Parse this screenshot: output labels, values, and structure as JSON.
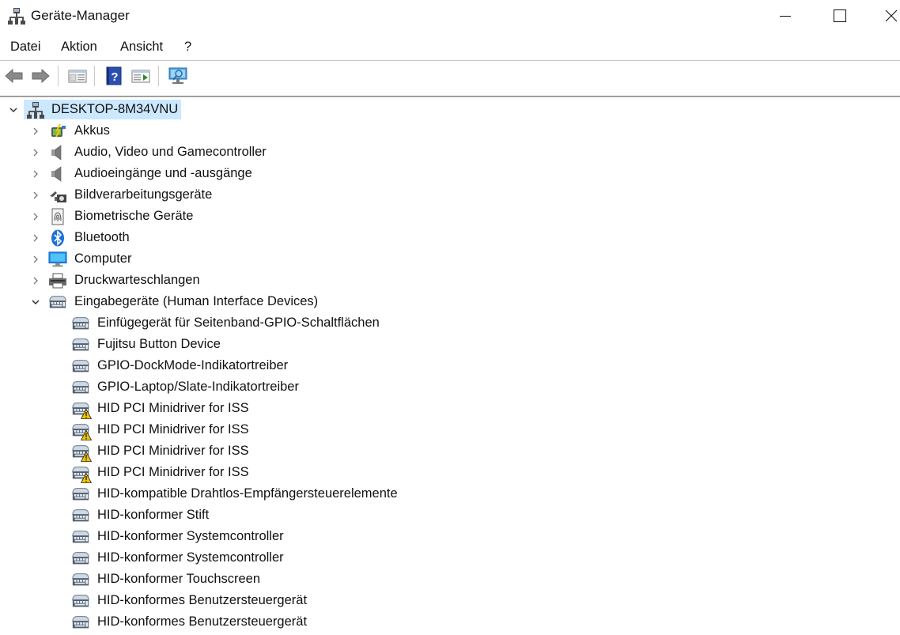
{
  "window": {
    "title": "Geräte-Manager"
  },
  "menu": [
    {
      "label": "Datei"
    },
    {
      "label": "Aktion"
    },
    {
      "label": "Ansicht"
    },
    {
      "label": "?"
    }
  ],
  "toolbar": {
    "buttons": [
      "back-arrow-icon",
      "forward-arrow-icon",
      "properties-pane-icon",
      "help-icon",
      "action-pane-icon",
      "scan-hardware-icon"
    ]
  },
  "tree": {
    "root": {
      "label": "DESKTOP-8M34VNU",
      "icon": "computer-network-icon",
      "expanded": true
    },
    "categories": [
      {
        "label": "Akkus",
        "icon": "battery-icon",
        "expanded": false
      },
      {
        "label": "Audio, Video und Gamecontroller",
        "icon": "speaker-icon",
        "expanded": false
      },
      {
        "label": "Audioeingänge und -ausgänge",
        "icon": "speaker-icon",
        "expanded": false
      },
      {
        "label": "Bildverarbeitungsgeräte",
        "icon": "camera-icon",
        "expanded": false
      },
      {
        "label": "Biometrische Geräte",
        "icon": "fingerprint-icon",
        "expanded": false
      },
      {
        "label": "Bluetooth",
        "icon": "bluetooth-icon",
        "expanded": false
      },
      {
        "label": "Computer",
        "icon": "monitor-icon",
        "expanded": false
      },
      {
        "label": "Druckwarteschlangen",
        "icon": "printer-icon",
        "expanded": false
      },
      {
        "label": "Eingabegeräte (Human Interface Devices)",
        "icon": "hid-icon",
        "expanded": true
      }
    ],
    "hid_children": [
      {
        "label": "Einfügegerät für Seitenband-GPIO-Schaltflächen",
        "warning": false
      },
      {
        "label": "Fujitsu Button Device",
        "warning": false
      },
      {
        "label": "GPIO-DockMode-Indikatortreiber",
        "warning": false
      },
      {
        "label": "GPIO-Laptop/Slate-Indikatortreiber",
        "warning": false
      },
      {
        "label": "HID PCI Minidriver for ISS",
        "warning": true
      },
      {
        "label": "HID PCI Minidriver for ISS",
        "warning": true
      },
      {
        "label": "HID PCI Minidriver for ISS",
        "warning": true
      },
      {
        "label": "HID PCI Minidriver for ISS",
        "warning": true
      },
      {
        "label": "HID-kompatible Drahtlos-Empfängersteuerelemente",
        "warning": false
      },
      {
        "label": "HID-konformer Stift",
        "warning": false
      },
      {
        "label": "HID-konformer Systemcontroller",
        "warning": false
      },
      {
        "label": "HID-konformer Systemcontroller",
        "warning": false
      },
      {
        "label": "HID-konformer Touchscreen",
        "warning": false
      },
      {
        "label": "HID-konformes Benutzersteuergerät",
        "warning": false
      },
      {
        "label": "HID-konformes Benutzersteuergerät",
        "warning": false
      }
    ]
  },
  "colors": {
    "selection": "#cce8ff",
    "warning": "#f5c400"
  }
}
